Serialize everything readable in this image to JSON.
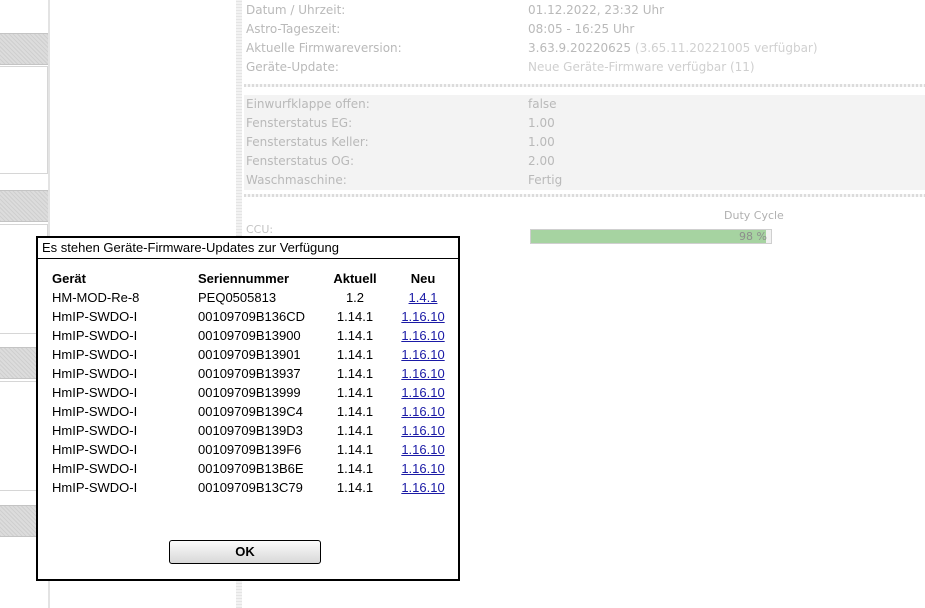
{
  "system_info": {
    "rows": [
      {
        "label": "Datum / Uhrzeit:",
        "value": "01.12.2022, 23:32 Uhr"
      },
      {
        "label": "Astro-Tageszeit:",
        "value": "08:05 - 16:25 Uhr"
      },
      {
        "label": "Aktuelle Firmwareversion:",
        "value": "3.63.9.20220625",
        "note": "(3.65.11.20221005 verfügbar)"
      },
      {
        "label": "Geräte-Update:",
        "value": "Neue Geräte-Firmware verfügbar (11)"
      }
    ]
  },
  "sysvars": {
    "rows": [
      {
        "label": "Einwurfklappe offen:",
        "value": "false"
      },
      {
        "label": "Fensterstatus EG:",
        "value": "1.00"
      },
      {
        "label": "Fensterstatus Keller:",
        "value": "1.00"
      },
      {
        "label": "Fensterstatus OG:",
        "value": "2.00"
      },
      {
        "label": "Waschmaschine:",
        "value": "Fertig"
      }
    ]
  },
  "duty_cycle": {
    "title": "Duty Cycle",
    "ccu_label": "CCU:",
    "percent": 98,
    "text": "98 %"
  },
  "dialog": {
    "title": "Es stehen Geräte-Firmware-Updates zur Verfügung",
    "headers": {
      "device": "Gerät",
      "serial": "Seriennummer",
      "current": "Aktuell",
      "new": "Neu"
    },
    "rows": [
      {
        "device": "HM-MOD-Re-8",
        "serial": "PEQ0505813",
        "current": "1.2",
        "new": "1.4.1"
      },
      {
        "device": "HmIP-SWDO-I",
        "serial": "00109709B136CD",
        "current": "1.14.1",
        "new": "1.16.10"
      },
      {
        "device": "HmIP-SWDO-I",
        "serial": "00109709B13900",
        "current": "1.14.1",
        "new": "1.16.10"
      },
      {
        "device": "HmIP-SWDO-I",
        "serial": "00109709B13901",
        "current": "1.14.1",
        "new": "1.16.10"
      },
      {
        "device": "HmIP-SWDO-I",
        "serial": "00109709B13937",
        "current": "1.14.1",
        "new": "1.16.10"
      },
      {
        "device": "HmIP-SWDO-I",
        "serial": "00109709B13999",
        "current": "1.14.1",
        "new": "1.16.10"
      },
      {
        "device": "HmIP-SWDO-I",
        "serial": "00109709B139C4",
        "current": "1.14.1",
        "new": "1.16.10"
      },
      {
        "device": "HmIP-SWDO-I",
        "serial": "00109709B139D3",
        "current": "1.14.1",
        "new": "1.16.10"
      },
      {
        "device": "HmIP-SWDO-I",
        "serial": "00109709B139F6",
        "current": "1.14.1",
        "new": "1.16.10"
      },
      {
        "device": "HmIP-SWDO-I",
        "serial": "00109709B13B6E",
        "current": "1.14.1",
        "new": "1.16.10"
      },
      {
        "device": "HmIP-SWDO-I",
        "serial": "00109709B13C79",
        "current": "1.14.1",
        "new": "1.16.10"
      }
    ],
    "ok_label": "OK"
  }
}
